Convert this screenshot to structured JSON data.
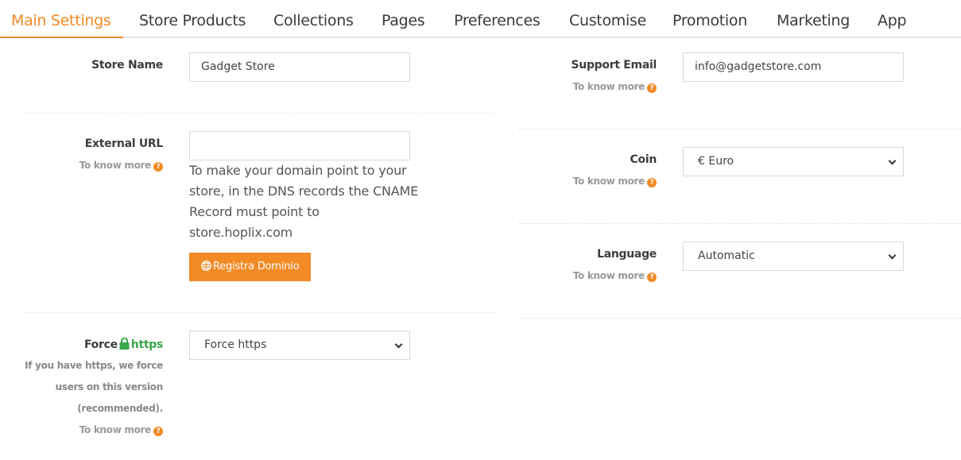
{
  "tabs": [
    {
      "label": "Main Settings",
      "active": true
    },
    {
      "label": "Store Products"
    },
    {
      "label": "Collections"
    },
    {
      "label": "Pages"
    },
    {
      "label": "Preferences"
    },
    {
      "label": "Customise"
    },
    {
      "label": "Promotion"
    },
    {
      "label": "Marketing"
    },
    {
      "label": "App"
    }
  ],
  "help_icon": "question-circle-icon",
  "accent_color": "#f28a25",
  "left": {
    "store_name": {
      "label": "Store Name",
      "value": "Gadget Store"
    },
    "external_url": {
      "label": "External URL",
      "know_more": "To know more",
      "value": "",
      "dns_text": "To make your domain point to your store, in the DNS records the CNAME Record must point to store.hoplix.com",
      "button_label": "Registra Dominio",
      "button_icon": "globe-icon"
    },
    "force_https": {
      "label_prefix": "Force",
      "label_icon": "lock-icon",
      "label_suffix": "https",
      "description": "If you have https, we force users on this version (recommended).",
      "know_more": "To know more",
      "selected": "Force https"
    }
  },
  "right": {
    "support_email": {
      "label": "Support Email",
      "know_more": "To know more",
      "value": "info@gadgetstore.com"
    },
    "coin": {
      "label": "Coin",
      "know_more": "To know more",
      "selected": "€ Euro"
    },
    "language": {
      "label": "Language",
      "know_more": "To know more",
      "selected": "Automatic"
    }
  }
}
